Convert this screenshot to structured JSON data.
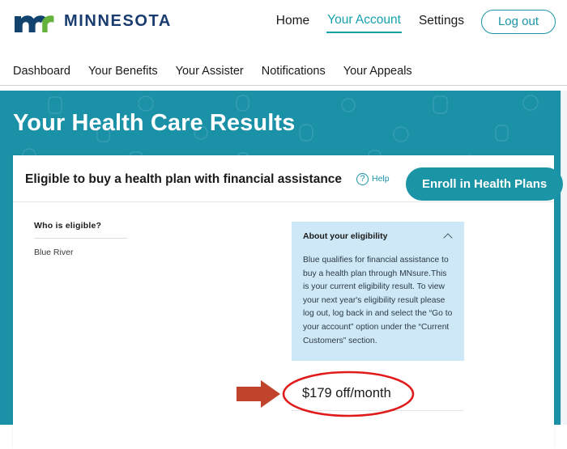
{
  "header": {
    "brand_name": "MINNESOTA",
    "brand_logo_icon": "mn-logo-icon",
    "nav": [
      {
        "label": "Home",
        "active": false
      },
      {
        "label": "Your Account",
        "active": true
      },
      {
        "label": "Settings",
        "active": false
      }
    ],
    "logout_label": "Log out"
  },
  "subnav": {
    "items": [
      {
        "label": "Dashboard"
      },
      {
        "label": "Your Benefits"
      },
      {
        "label": "Your Assister"
      },
      {
        "label": "Notifications"
      },
      {
        "label": "Your Appeals"
      }
    ]
  },
  "banner": {
    "title": "Your Health Care Results",
    "background_color": "#1b91a8"
  },
  "card": {
    "title": "Eligible to buy a health plan with financial assistance",
    "help_icon": "question-circle-icon",
    "help_label": "Help",
    "enroll_label": "Enroll in Health Plans",
    "who": {
      "title": "Who is eligible?",
      "names": [
        "Blue River"
      ]
    },
    "info_panel": {
      "title": "About your eligibility",
      "collapse_icon": "chevron-up-icon",
      "body": "Blue qualifies for financial assistance to buy a health plan through MNsure.This is your current eligibility result. To view your next year's eligibility result please log out, log back in and select the “Go to your account” option under the “Current Customers” section.",
      "background_color": "#cfe8f7"
    },
    "savings": {
      "amount_text": "$179 off/month"
    }
  },
  "annotations": {
    "arrow_icon": "right-arrow-annotation-icon",
    "arrow_color": "#c0432c",
    "ellipse_icon": "red-ellipse-annotation-icon",
    "ellipse_color": "#e01b1b"
  },
  "colors": {
    "teal": "#1b91a8",
    "teal_accent": "#1b94a6",
    "brand_blue": "#1a3c6e",
    "brand_green": "#5aa83c",
    "panel_blue": "#cfe8f7"
  }
}
